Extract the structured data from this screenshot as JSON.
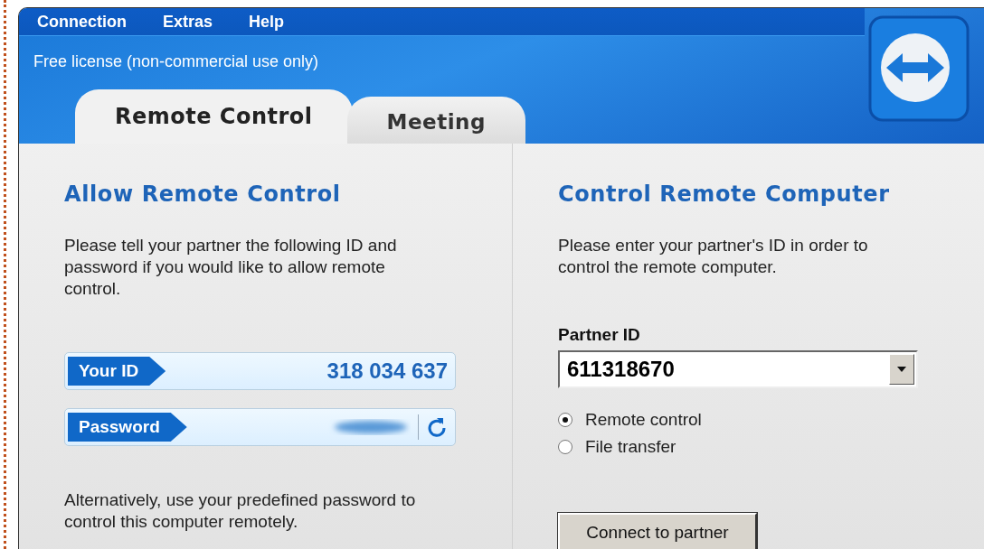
{
  "menu": [
    "Connection",
    "Extras",
    "Help"
  ],
  "license": "Free license (non-commercial use only)",
  "tabs": [
    {
      "label": "Remote Control",
      "selected": true
    },
    {
      "label": "Meeting",
      "selected": false
    }
  ],
  "allow": {
    "title": "Allow Remote Control",
    "text": "Please tell your partner the following ID and password if you would like to allow remote control.",
    "id_label": "Your ID",
    "id_value": "318 034 637",
    "password_label": "Password",
    "note": "Alternatively, use your predefined password to control this computer remotely."
  },
  "control": {
    "title": "Control Remote Computer",
    "text": "Please enter your partner's ID in order to control the remote computer.",
    "partner_label": "Partner ID",
    "partner_id": "611318670",
    "options": [
      {
        "label": "Remote control",
        "selected": true
      },
      {
        "label": "File transfer",
        "selected": false
      }
    ],
    "button": "Connect to partner"
  }
}
